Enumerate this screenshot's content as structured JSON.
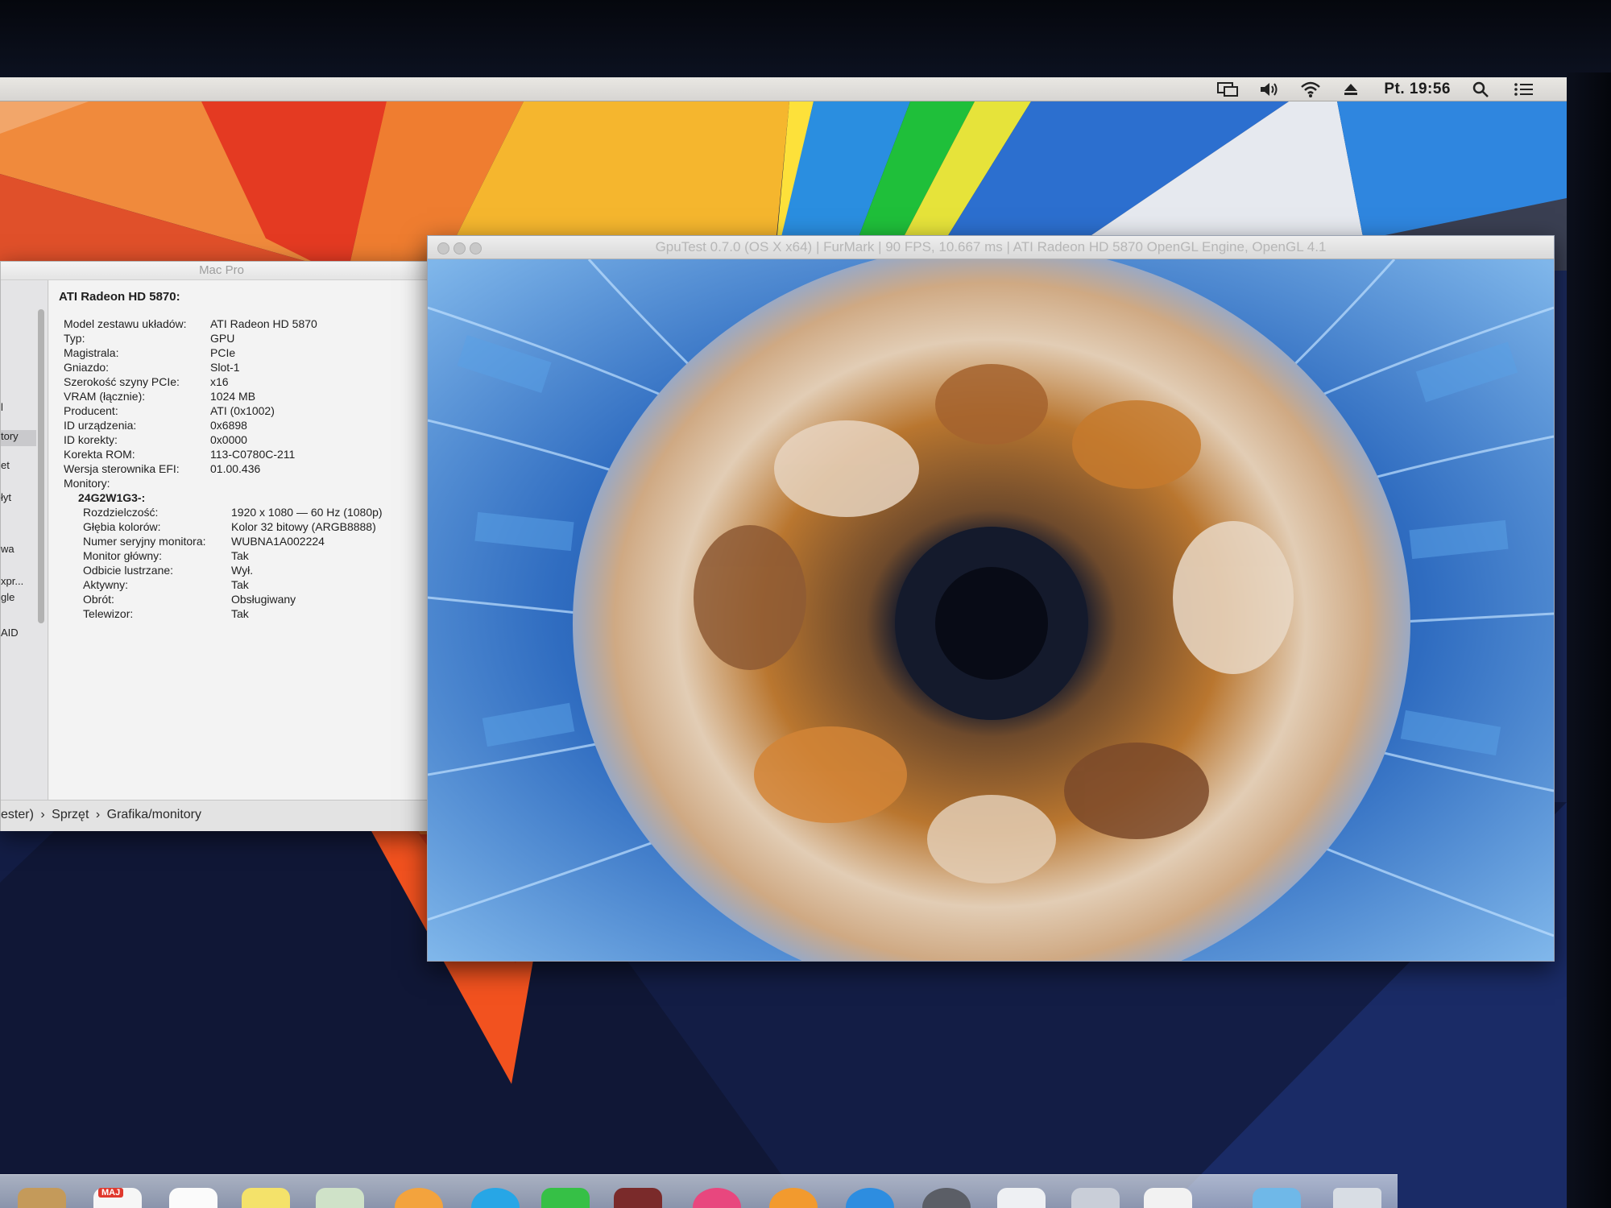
{
  "menubar": {
    "clock": "Pt. 19:56",
    "icons": [
      "display-mirroring-icon",
      "volume-icon",
      "wifi-icon",
      "eject-icon",
      "spotlight-search-icon",
      "notification-center-icon"
    ]
  },
  "sysinfo": {
    "window_title": "Mac Pro",
    "device_title": "ATI Radeon HD 5870:",
    "sidebar_items": [
      "l",
      "tory",
      "et",
      "łyt",
      "wa",
      "xpr...",
      "gle",
      "AID"
    ],
    "selected_sidebar_index": 1,
    "properties": [
      {
        "key": "Model zestawu układów:",
        "value": "ATI Radeon HD 5870"
      },
      {
        "key": "Typ:",
        "value": "GPU"
      },
      {
        "key": "Magistrala:",
        "value": "PCIe"
      },
      {
        "key": "Gniazdo:",
        "value": "Slot-1"
      },
      {
        "key": "Szerokość szyny PCIe:",
        "value": "x16"
      },
      {
        "key": "VRAM (łącznie):",
        "value": "1024  MB"
      },
      {
        "key": "Producent:",
        "value": "ATI (0x1002)"
      },
      {
        "key": "ID urządzenia:",
        "value": "0x6898"
      },
      {
        "key": "ID korekty:",
        "value": "0x0000"
      },
      {
        "key": "Korekta ROM:",
        "value": "113-C0780C-211"
      },
      {
        "key": "Wersja sterownika EFI:",
        "value": "01.00.436"
      },
      {
        "key": "Monitory:",
        "value": ""
      }
    ],
    "monitor_name": "24G2W1G3-:",
    "monitor_properties": [
      {
        "key": "Rozdzielczość:",
        "value": "1920 x 1080 — 60 Hz (1080p)"
      },
      {
        "key": "Głębia kolorów:",
        "value": "Kolor 32 bitowy (ARGB8888)"
      },
      {
        "key": "Numer seryjny monitora:",
        "value": "WUBNA1A002224"
      },
      {
        "key": "Monitor główny:",
        "value": "Tak"
      },
      {
        "key": "Odbicie lustrzane:",
        "value": "Wył."
      },
      {
        "key": "Aktywny:",
        "value": "Tak"
      },
      {
        "key": "Obrót:",
        "value": "Obsługiwany"
      },
      {
        "key": "Telewizor:",
        "value": "Tak"
      }
    ],
    "path": [
      "ester)",
      "›",
      "Sprzęt",
      "›",
      "Grafika/monitory"
    ]
  },
  "gputest": {
    "title": "GpuTest 0.7.0 (OS X x64) | FurMark | 90 FPS, 10.667 ms | ATI Radeon HD 5870 OpenGL Engine, OpenGL 4.1"
  },
  "dock": {
    "calendar_badge": "MAJ",
    "icons": [
      "finder-icon",
      "calendar-icon",
      "notes-icon",
      "stickies-icon",
      "preview-icon",
      "photos-icon",
      "safari-icon",
      "messages-icon",
      "photo-booth-icon",
      "itunes-icon",
      "ibooks-icon",
      "app-store-icon",
      "system-preferences-icon",
      "document-icon",
      "automator-icon",
      "textedit-icon",
      "folder-icon",
      "trash-icon"
    ]
  }
}
